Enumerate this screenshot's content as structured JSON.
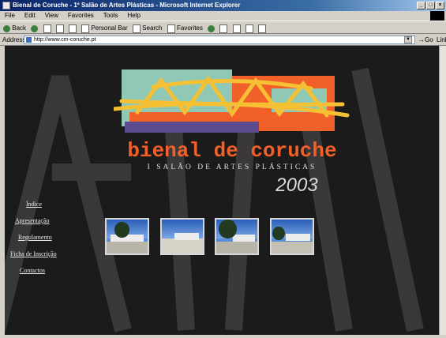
{
  "browser": {
    "title": "Bienal de Coruche - 1º Salão de Artes Plásticas - Microsoft Internet Explorer",
    "menu": [
      "File",
      "Edit",
      "View",
      "Favorites",
      "Tools",
      "Help"
    ],
    "toolbar": {
      "back": "Back",
      "personal_bar": "Personal Bar",
      "search": "Search",
      "favorites": "Favorites"
    },
    "address_label": "Address",
    "url": "http://www.cm-coruche.pt",
    "go_label": "Go",
    "links_label": "Link"
  },
  "page": {
    "logo_title": "bienal de coruche",
    "logo_subtitle": "I SALÃO DE ARTES PLÁSTICAS",
    "logo_year": "2003",
    "nav": [
      "Índice",
      "Apresentação",
      "Regulamento",
      "Ficha de Inscrição",
      "Contactos"
    ],
    "colors": {
      "background": "#1c1b1b",
      "accent_orange": "#f2602a",
      "logo_teal": "#8fc9b5",
      "logo_purple": "#5c4a8f",
      "logo_yellow": "#f5c033"
    }
  }
}
